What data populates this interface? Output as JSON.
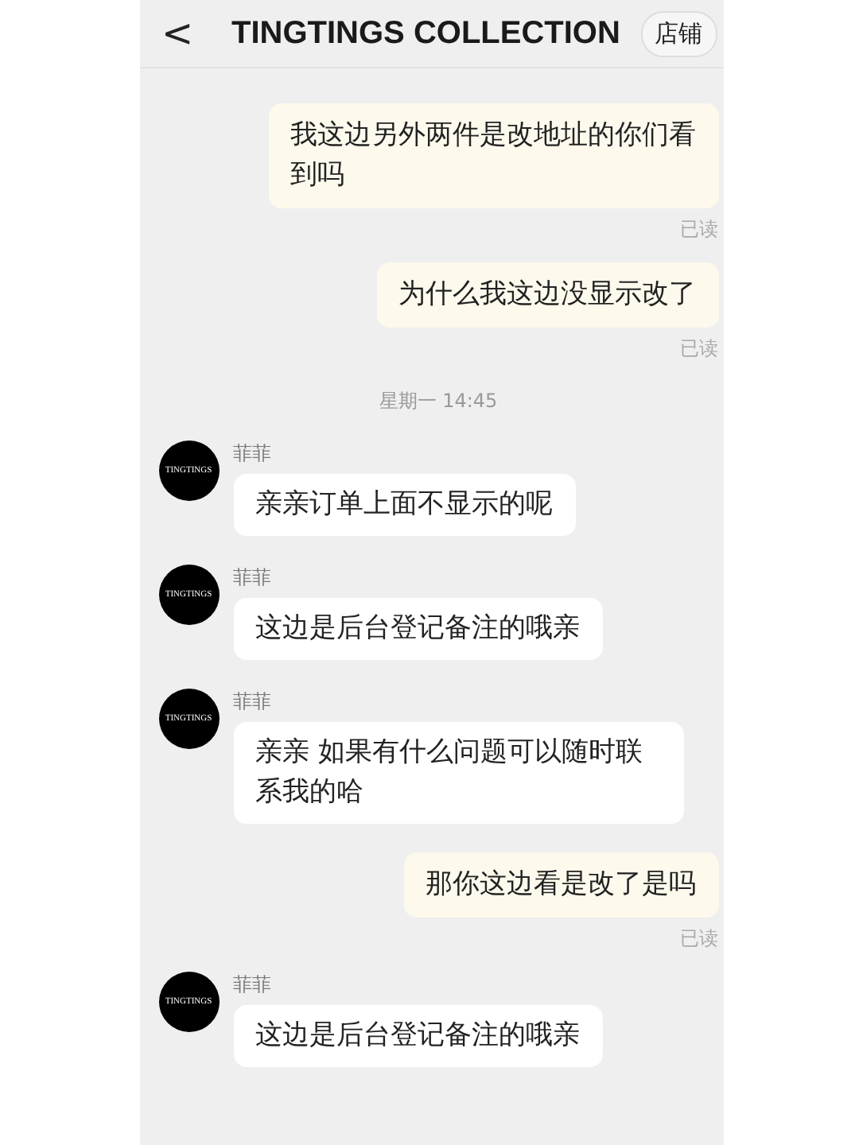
{
  "header": {
    "back": "<",
    "title": "TINGTINGS COLLECTION",
    "shop_button": "店铺"
  },
  "messages": [
    {
      "kind": "sent",
      "text": "我这边另外两件是改地址的你们看到吗",
      "status": "已读"
    },
    {
      "kind": "sent",
      "text": "为什么我这边没显示改了",
      "status": "已读"
    },
    {
      "kind": "time",
      "text": "星期一 14:45"
    },
    {
      "kind": "received",
      "avatar": "TINGTINGS",
      "name": "菲菲",
      "text": "亲亲订单上面不显示的呢"
    },
    {
      "kind": "received",
      "avatar": "TINGTINGS",
      "name": "菲菲",
      "text": "这边是后台登记备注的哦亲"
    },
    {
      "kind": "received",
      "avatar": "TINGTINGS",
      "name": "菲菲",
      "text": "亲亲 如果有什么问题可以随时联系我的哈"
    },
    {
      "kind": "sent",
      "text": "那你这边看是改了是吗",
      "status": "已读"
    },
    {
      "kind": "received",
      "avatar": "TINGTINGS",
      "name": "菲菲",
      "text": "这边是后台登记备注的哦亲"
    }
  ]
}
